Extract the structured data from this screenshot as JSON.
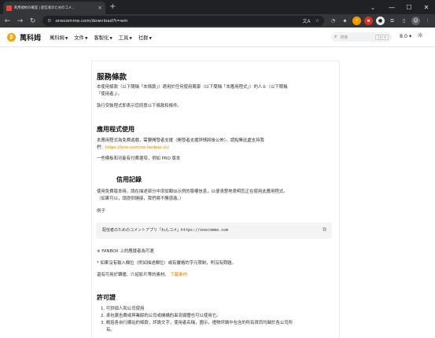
{
  "browser": {
    "tab_title": "利用規約の確認 | 配信者のためのコメ...",
    "tab_close": "×",
    "new_tab": "+",
    "tab_search": "⌄",
    "window_controls": {
      "minimize": "—",
      "maximize": "☐",
      "close": "✕"
    },
    "nav": {
      "back": "←",
      "forward": "→",
      "reload": "↻"
    },
    "site_info": "⚙",
    "url": "onecomme.com/download?t=win",
    "omnibox_icons": {
      "translate": "文A",
      "bookmark": "☆"
    },
    "extensions": [
      {
        "name": "extension-icon-1",
        "glyph": "◔"
      },
      {
        "name": "extension-icon-2",
        "glyph": "⬥"
      },
      {
        "name": "extension-icon-3",
        "glyph": "⚡"
      },
      {
        "name": "extension-icon-4",
        "glyph": "✖"
      },
      {
        "name": "extension-icon-5",
        "glyph": "●"
      },
      {
        "name": "extensions-puzzle-icon",
        "glyph": "⧉"
      },
      {
        "name": "sidepanel-icon",
        "glyph": "▯"
      },
      {
        "name": "profile-avatar",
        "glyph": "☺"
      },
      {
        "name": "menu-dots-icon",
        "glyph": "⋮"
      }
    ]
  },
  "site": {
    "logo_glyph": "₿",
    "brand": "萬科姆",
    "menu": [
      {
        "name": "menu-brand",
        "label": "萬科姆"
      },
      {
        "name": "menu-docs",
        "label": "文件"
      },
      {
        "name": "menu-support",
        "label": "客製化"
      },
      {
        "name": "menu-tools",
        "label": "工具"
      },
      {
        "name": "menu-community",
        "label": "社群"
      }
    ],
    "caret": "▼",
    "search_placeholder": "搜索",
    "search_shortcut": "Ctrl K",
    "version": "8.0 ▾",
    "theme_icon": "☼"
  },
  "doc": {
    "title": "服務條款",
    "intro_1": "本使用條款（以下簡稱「本條款」）適用於任何使用萬康（以下簡稱「本應用程式」）的人士（以下簡稱",
    "intro_2": "「使用者」）。",
    "intro_3": "執行安裝程式即表示您同意以下條款和條件。",
    "app_heading": "應用程式使用",
    "app_p1": "本應用程式為免費遊戲，需要開發者支援（開發者支援詳情將後公佈）。請點擊此處支持我",
    "app_p1b_prefix": "們：",
    "support_link": "https://one-comme.fanbox.cc/",
    "app_p2": "一些模板和功能有付費選項，例如 PRO 版本",
    "credit_heading": "信用記錄",
    "credit_p1": "使用免費版本時，請在描述部分中添加類似示例的版權信息，以便清楚地表明您正在使用此應用程式。",
    "credit_p2": "（如果可以，請提供鏈接，我們將不勝感激。）",
    "example_label": "例子",
    "example_code": "配信者のためのコメントアプリ「わんコメ」https://onecomme.com",
    "copy_icon": "⧉",
    "fanbox_note": "※ FANBOX 上的應援者為可選",
    "note_2": "* 如果沒有輸入欄位（例如描述欄位）或有嚴格的字元限制，則沒有問題。",
    "note_3_prefix": "還有可用於轉播、介紹影片等的素材。",
    "download_link": "下載素材",
    "license_heading": "許可證",
    "license_items": [
      "1. 可供個人和公司使用",
      "2. 承包廣告費或與業餘的公司或機構的串流媒體也可以使用它。",
      "3. 概括各自行網站的條款，評論文字，使用者名稱，圖示，禮物評論中包含的所有資訊均歸於各公司所",
      "有。"
    ]
  }
}
